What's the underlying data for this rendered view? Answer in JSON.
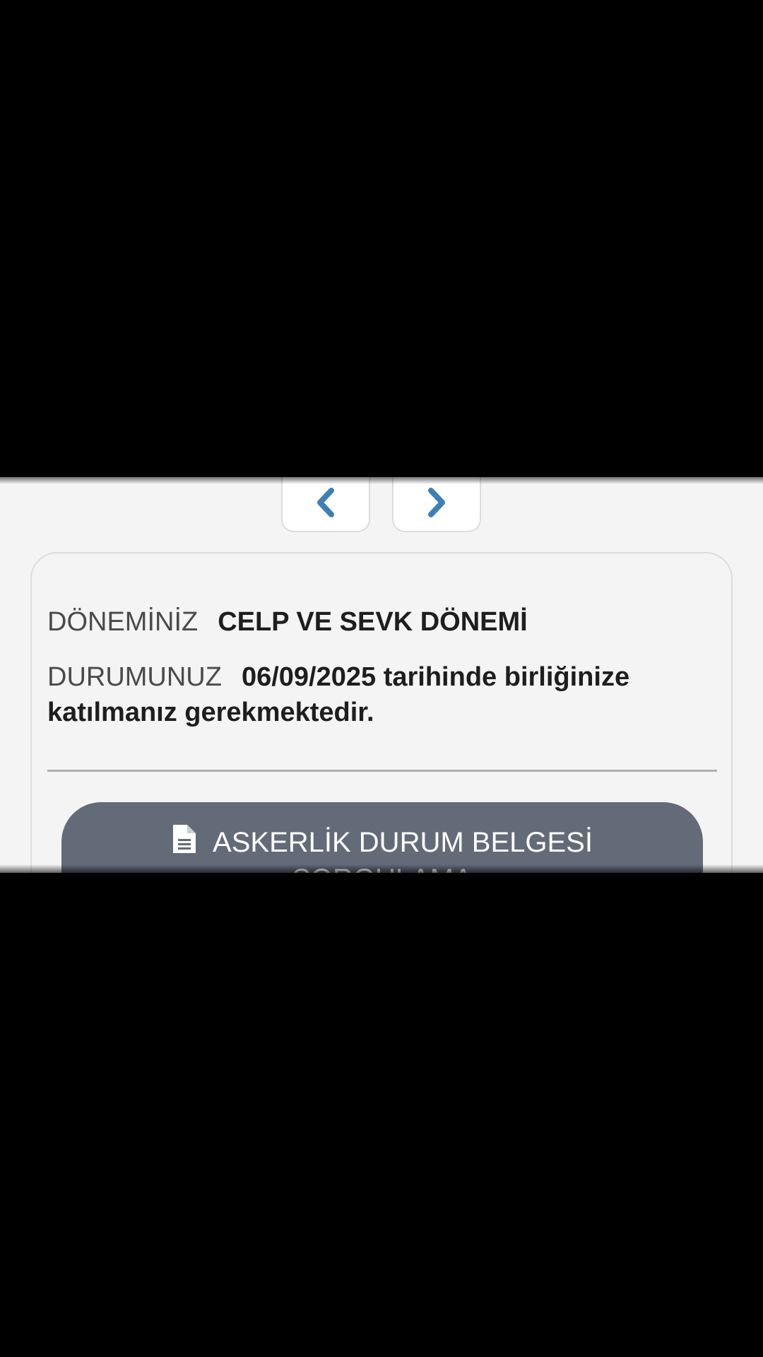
{
  "nav": {
    "prev_icon": "chevron-left-icon",
    "next_icon": "chevron-right-icon",
    "icon_color": "#3d7fb6"
  },
  "status": {
    "period_label": "DÖNEMİNİZ",
    "period_value": "CELP VE SEVK DÖNEMİ",
    "status_label": "DURUMUNUZ",
    "status_value": "06/09/2025 tarihinde birliğinize katılmanız gerekmektedir."
  },
  "action": {
    "icon": "document-icon",
    "label": "ASKERLİK DURUM BELGESİ SORGULAMA",
    "background": "#636b78"
  }
}
